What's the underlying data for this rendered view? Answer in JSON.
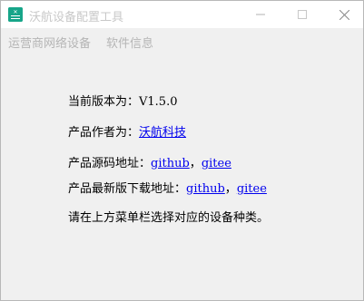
{
  "window": {
    "title": "沃航设备配置工具",
    "icon_name": "app-logo-icon",
    "controls": [
      "minimize-icon",
      "maximize-icon",
      "close-icon"
    ]
  },
  "menu": {
    "items": [
      {
        "label": "运营商网络设备"
      },
      {
        "label": "软件信息"
      }
    ]
  },
  "info": {
    "version_label": "当前版本为：",
    "version_value": "V1.5.0",
    "author_label": "产品作者为：",
    "author_link": "沃航科技",
    "source_label": "产品源码地址：",
    "source_link_1": "github",
    "source_sep": "，",
    "source_link_2": "gitee",
    "download_label": "产品最新版下载地址：",
    "download_link_1": "github",
    "download_sep": "，",
    "download_link_2": "gitee",
    "hint": "请在上方菜单栏选择对应的设备种类。"
  },
  "colors": {
    "link": "#0000ee",
    "app_icon": "#17a589"
  }
}
